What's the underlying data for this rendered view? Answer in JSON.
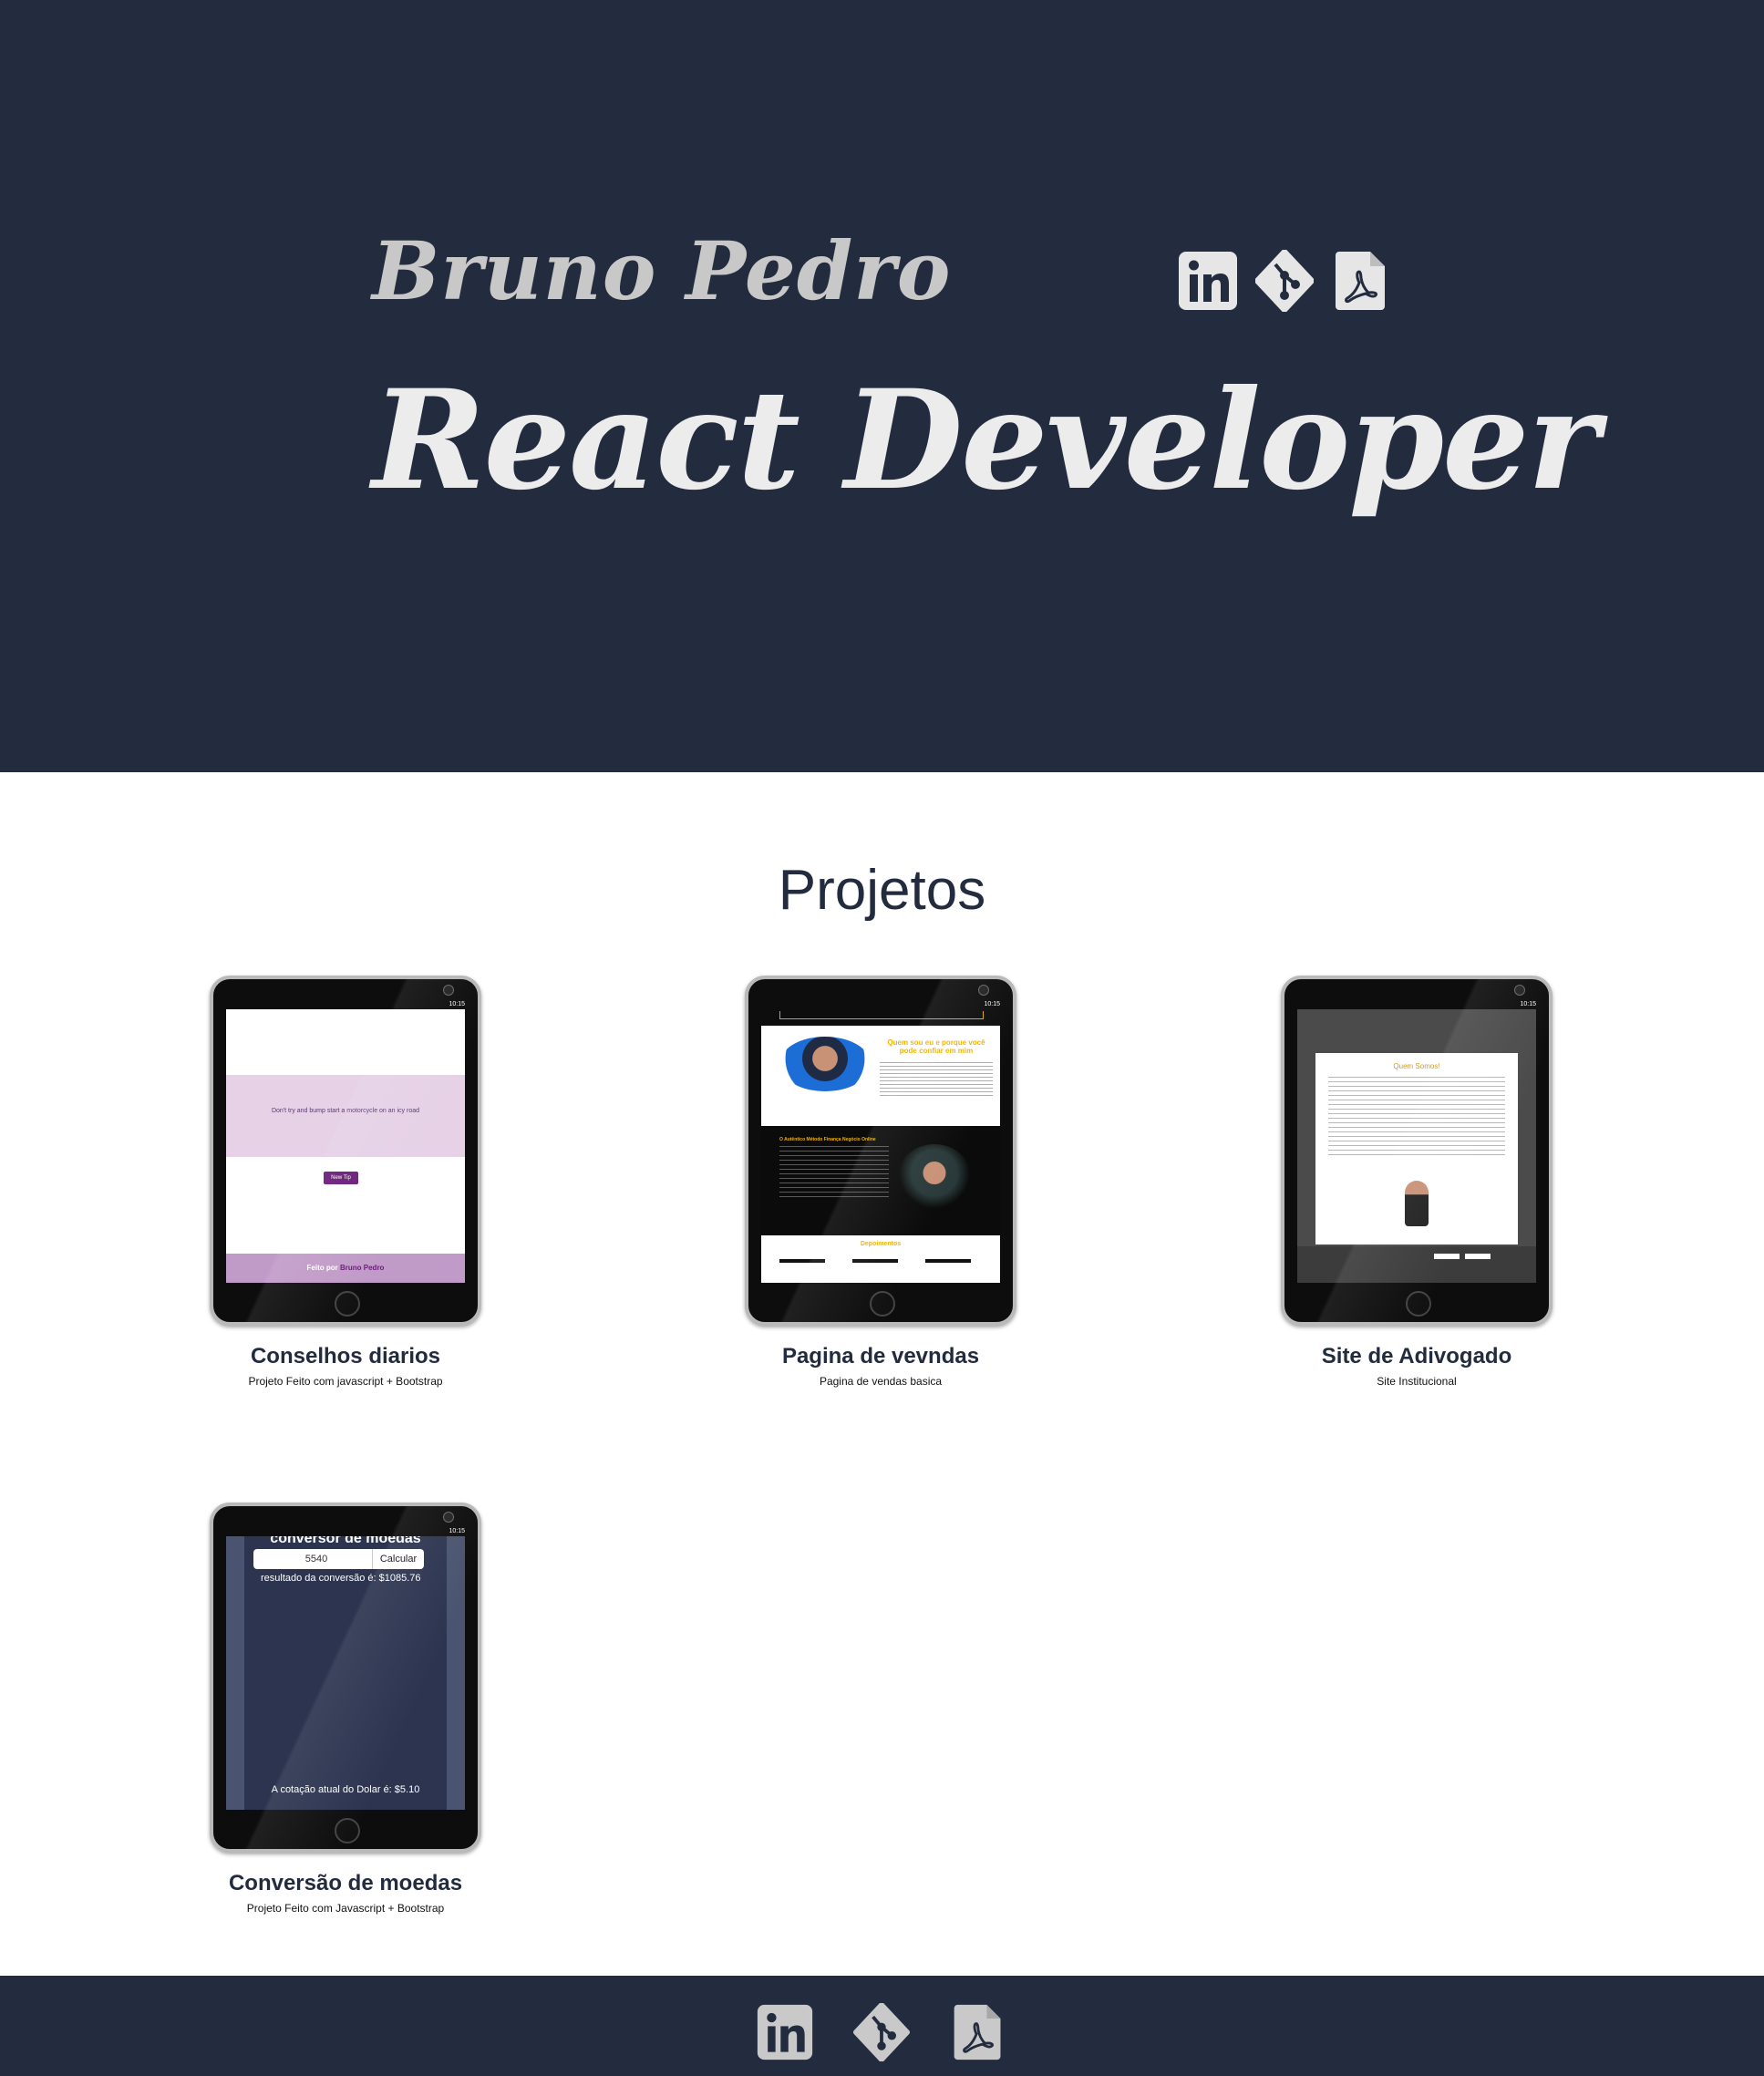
{
  "hero": {
    "name": "Bruno Pedro",
    "title": "React Developer",
    "icons": [
      "linkedin-icon",
      "git-icon",
      "pdf-icon"
    ]
  },
  "projects_title": "Projetos",
  "projects": [
    {
      "title": "Conselhos diarios",
      "subtitle": "Projeto Feito com javascript + Bootstrap",
      "screen": {
        "time": "10:15",
        "advice": "Don't try and bump start a motorcycle on an icy road",
        "button": "New Tip",
        "footer_prefix": "Feito por",
        "footer_name": "Bruno Pedro"
      }
    },
    {
      "title": "Pagina de vevndas",
      "subtitle": "Pagina de vendas basica",
      "screen": {
        "time": "10:15",
        "headline": "Quem sou eu e porque você pode confiar em mim",
        "section": "O Autêntico Método Finança Negócio Online",
        "depo": "Depoimentos"
      }
    },
    {
      "title": "Site de Adivogado",
      "subtitle": "Site Institucional",
      "screen": {
        "time": "10:15",
        "heading": "Quem Somos!"
      }
    },
    {
      "title": "Conversão de moedas",
      "subtitle": "Projeto Feito com Javascript + Bootstrap",
      "screen": {
        "time": "10:15",
        "heading": "conversor de moedas",
        "input_value": "5540",
        "button": "Calcular",
        "result": "resultado da conversão é: $1085.76",
        "quote": "A cotação atual do Dolar é: $5.10"
      }
    }
  ],
  "colors": {
    "navy": "#232b3e",
    "white": "#ffffff",
    "accent_purple": "#6a1b79",
    "accent_gold": "#f1b200"
  }
}
